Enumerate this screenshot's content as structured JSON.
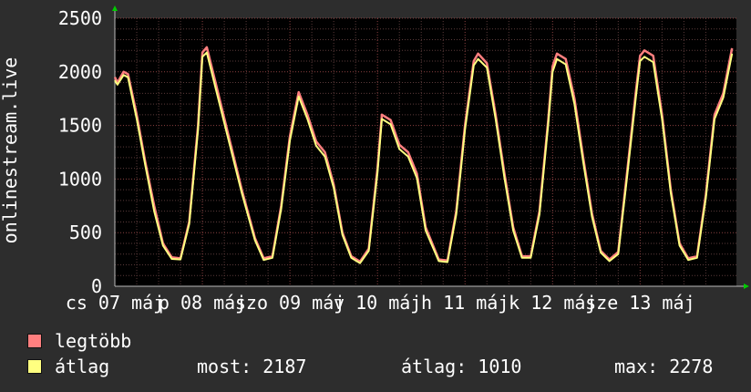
{
  "chart_data": {
    "type": "line",
    "ylabel": "onlinestream.live",
    "ylim": [
      0,
      2500
    ],
    "yticks": [
      0,
      500,
      1000,
      1500,
      2000,
      2500
    ],
    "xlim": [
      0,
      7.1
    ],
    "xticks": [
      {
        "x": 0,
        "label": "cs 07 máj"
      },
      {
        "x": 1,
        "label": "p 08 máj"
      },
      {
        "x": 2,
        "label": "szo 09 máj"
      },
      {
        "x": 3,
        "label": "v 10 máj"
      },
      {
        "x": 4,
        "label": "h 11 máj"
      },
      {
        "x": 5,
        "label": "k 12 máj"
      },
      {
        "x": 6,
        "label": "sze 13 máj"
      }
    ],
    "grid": true,
    "series": [
      {
        "name": "legtöbb",
        "color": "#ff7f7f",
        "x": [
          0,
          0.03,
          0.1,
          0.15,
          0.25,
          0.35,
          0.45,
          0.55,
          0.65,
          0.75,
          0.85,
          0.95,
          1.0,
          1.05,
          1.15,
          1.3,
          1.45,
          1.6,
          1.7,
          1.8,
          1.9,
          2.0,
          2.1,
          2.2,
          2.3,
          2.4,
          2.5,
          2.6,
          2.7,
          2.8,
          2.9,
          3.0,
          3.05,
          3.15,
          3.25,
          3.35,
          3.45,
          3.55,
          3.7,
          3.8,
          3.9,
          4.0,
          4.1,
          4.15,
          4.25,
          4.35,
          4.45,
          4.55,
          4.65,
          4.75,
          4.85,
          4.95,
          5.0,
          5.05,
          5.15,
          5.25,
          5.35,
          5.45,
          5.55,
          5.65,
          5.75,
          5.85,
          5.95,
          6.0,
          6.05,
          6.15,
          6.25,
          6.35,
          6.45,
          6.55,
          6.65,
          6.75,
          6.85,
          6.95,
          7.05
        ],
        "values": [
          1950,
          1900,
          2000,
          1980,
          1600,
          1150,
          750,
          400,
          270,
          260,
          600,
          1500,
          2180,
          2230,
          1900,
          1400,
          900,
          450,
          260,
          280,
          750,
          1400,
          1810,
          1600,
          1350,
          1250,
          950,
          500,
          280,
          230,
          350,
          1100,
          1600,
          1550,
          1320,
          1250,
          1050,
          550,
          250,
          240,
          700,
          1500,
          2100,
          2170,
          2080,
          1600,
          1050,
          550,
          280,
          280,
          700,
          1550,
          2050,
          2170,
          2120,
          1750,
          1200,
          680,
          330,
          250,
          320,
          1050,
          1800,
          2150,
          2200,
          2150,
          1600,
          900,
          400,
          260,
          280,
          850,
          1600,
          1800,
          2220
        ]
      },
      {
        "name": "átlag",
        "color": "#ffff80",
        "x": [
          0,
          0.03,
          0.1,
          0.15,
          0.25,
          0.35,
          0.45,
          0.55,
          0.65,
          0.75,
          0.85,
          0.95,
          1.0,
          1.05,
          1.15,
          1.3,
          1.45,
          1.6,
          1.7,
          1.8,
          1.9,
          2.0,
          2.1,
          2.2,
          2.3,
          2.4,
          2.5,
          2.6,
          2.7,
          2.8,
          2.9,
          3.0,
          3.05,
          3.15,
          3.25,
          3.35,
          3.45,
          3.55,
          3.7,
          3.8,
          3.9,
          4.0,
          4.1,
          4.15,
          4.25,
          4.35,
          4.45,
          4.55,
          4.65,
          4.75,
          4.85,
          4.95,
          5.0,
          5.05,
          5.15,
          5.25,
          5.35,
          5.45,
          5.55,
          5.65,
          5.75,
          5.85,
          5.95,
          6.0,
          6.05,
          6.15,
          6.25,
          6.35,
          6.45,
          6.55,
          6.65,
          6.75,
          6.85,
          6.95,
          7.05
        ],
        "values": [
          1920,
          1880,
          1970,
          1950,
          1560,
          1120,
          700,
          380,
          255,
          250,
          580,
          1460,
          2140,
          2180,
          1850,
          1360,
          870,
          430,
          245,
          265,
          720,
          1360,
          1770,
          1560,
          1310,
          1210,
          920,
          480,
          265,
          215,
          330,
          1060,
          1560,
          1510,
          1280,
          1210,
          1010,
          520,
          235,
          225,
          670,
          1460,
          2060,
          2120,
          2040,
          1560,
          1010,
          520,
          265,
          265,
          670,
          1510,
          2000,
          2120,
          2070,
          1700,
          1160,
          650,
          315,
          235,
          300,
          1010,
          1750,
          2100,
          2140,
          2090,
          1560,
          870,
          380,
          245,
          265,
          820,
          1560,
          1760,
          2170
        ]
      }
    ]
  },
  "legend": [
    {
      "label": "legtöbb",
      "color": "#ff7f7f"
    },
    {
      "label": "átlag",
      "color": "#ffff80"
    }
  ],
  "stats": {
    "most": "most: 2187",
    "atlag": "átlag: 1010",
    "max": "max: 2278"
  }
}
